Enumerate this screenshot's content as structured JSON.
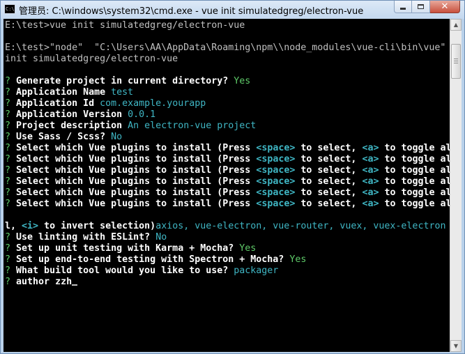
{
  "window": {
    "app_icon_text": "C:\\",
    "title": "管理员: C:\\windows\\system32\\cmd.exe - vue  init simulatedgreg/electron-vue"
  },
  "console": {
    "line1": "E:\\test>vue init simulatedgreg/electron-vue",
    "line2": "E:\\test>\"node\"  \"C:\\Users\\AA\\AppData\\Roaming\\npm\\\\node_modules\\vue-cli\\bin\\vue\"",
    "line3": "init simulatedgreg/electron-vue",
    "q_mark": "?",
    "prompts": [
      {
        "q": "Generate project in current directory?",
        "a": "Yes"
      },
      {
        "q": "Application Name",
        "a": "test"
      },
      {
        "q": "Application Id",
        "a": "com.example.yourapp"
      },
      {
        "q": "Application Version",
        "a": "0.0.1"
      },
      {
        "q": "Project description",
        "a": "An electron-vue project"
      },
      {
        "q": "Use Sass / Scss?",
        "a": "No"
      }
    ],
    "plugin_prompt": {
      "q": "Select which Vue plugins to install",
      "p1": "(Press",
      "k_space": "<space>",
      "p2": "to select,",
      "k_a": "<a>",
      "p3": "to toggle al"
    },
    "cont": {
      "p1": "l,",
      "k_i": "<i>",
      "p2": "to invert selection)",
      "a": "axios, vue-electron, vue-router, vuex, vuex-electron"
    },
    "prompts2": [
      {
        "q": "Use linting with ESLint?",
        "a": "No"
      },
      {
        "q": "Set up unit testing with Karma + Mocha?",
        "a": "Yes"
      },
      {
        "q": "Set up end-to-end testing with Spectron + Mocha?",
        "a": "Yes"
      },
      {
        "q": "What build tool would you like to use?",
        "a": "packager"
      }
    ],
    "author": {
      "q": "author",
      "a": "zzh"
    }
  },
  "colors": {
    "background": "#000000",
    "default_text": "#c0c0c0",
    "bold_text": "#ffffff",
    "question_mark_and_answers": "#5ec968",
    "key_hints": "#3fb6c4"
  },
  "icons": {
    "app": "cmd-icon",
    "minimize": "minimize-icon",
    "maximize": "maximize-icon",
    "close": "close-icon"
  }
}
